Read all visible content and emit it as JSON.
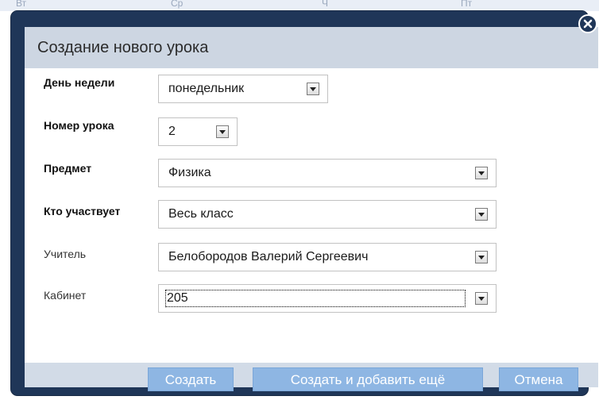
{
  "background": {
    "header_fragments": [
      "Вт",
      "Ср",
      "Ч",
      "Пт"
    ]
  },
  "modal": {
    "title": "Создание нового урока",
    "fields": [
      {
        "label": "День недели",
        "value": "понедельник"
      },
      {
        "label": "Номер урока",
        "value": "2"
      },
      {
        "label": "Предмет",
        "value": "Физика"
      },
      {
        "label": "Кто участвует",
        "value": "Весь класс"
      },
      {
        "label": "Учитель",
        "value": "Белобородов Валерий Сергеевич"
      },
      {
        "label": "Кабинет",
        "value": "205"
      }
    ],
    "buttons": {
      "create": "Создать",
      "create_add": "Создать и добавить ещё",
      "cancel": "Отмена"
    }
  },
  "colors": {
    "modal_frame": "#1f3658",
    "title_bar": "#cdd6e2",
    "button": "#8eb6e3",
    "footer": "#d2dbe7"
  },
  "icons": {
    "close": "close-icon",
    "dropdown": "chevron-down-icon"
  }
}
